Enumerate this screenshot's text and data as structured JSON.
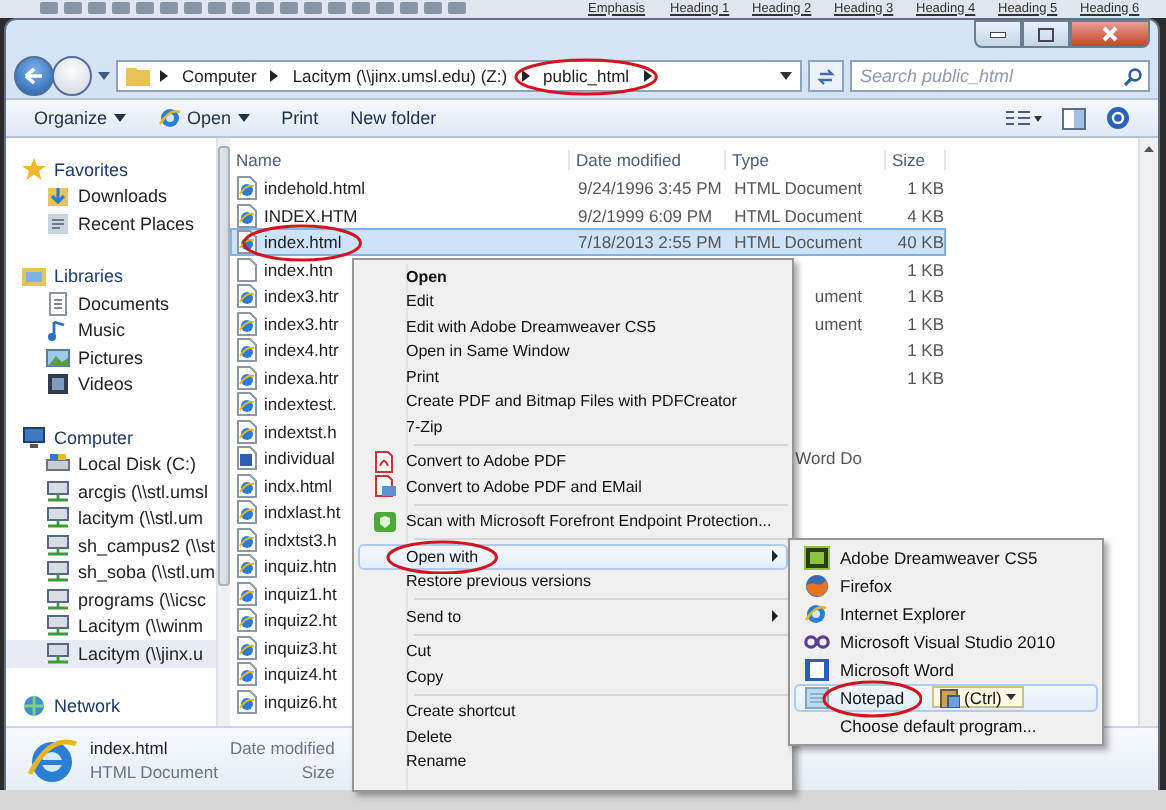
{
  "editor_ribbon": {
    "styles": [
      "Emphasis",
      "Heading 1",
      "Heading 2",
      "Heading 3",
      "Heading 4",
      "Heading 5",
      "Heading 6"
    ]
  },
  "address_bar": {
    "crumbs": [
      "Computer",
      "Lacitym (\\\\jinx.umsl.edu) (Z:)",
      "public_html"
    ]
  },
  "search": {
    "placeholder": "Search public_html"
  },
  "toolbar": {
    "buttons": [
      {
        "label": "Organize",
        "dropdown": true,
        "kind": "text"
      },
      {
        "label": "Open",
        "dropdown": true,
        "kind": "browser"
      },
      {
        "label": "Print",
        "dropdown": false,
        "kind": "text"
      },
      {
        "label": "New folder",
        "dropdown": false,
        "kind": "text"
      }
    ]
  },
  "navigation": {
    "groups": [
      {
        "label": "Favorites",
        "kind": "favorites",
        "children": [
          {
            "label": "Downloads",
            "kind": "downloads",
            "selected": false
          },
          {
            "label": "Recent Places",
            "kind": "recent",
            "selected": false
          }
        ]
      },
      {
        "label": "Libraries",
        "kind": "libraries",
        "children": [
          {
            "label": "Documents",
            "kind": "documents",
            "selected": false
          },
          {
            "label": "Music",
            "kind": "music",
            "selected": false
          },
          {
            "label": "Pictures",
            "kind": "pictures",
            "selected": false
          },
          {
            "label": "Videos",
            "kind": "videos",
            "selected": false
          }
        ]
      },
      {
        "label": "Computer",
        "kind": "computer",
        "children": [
          {
            "label": "Local Disk (C:)",
            "kind": "disk",
            "selected": false
          },
          {
            "label": "arcgis (\\\\stl.umsl",
            "kind": "share",
            "selected": false
          },
          {
            "label": "lacitym (\\\\stl.um",
            "kind": "share",
            "selected": false
          },
          {
            "label": "sh_campus2 (\\\\st",
            "kind": "share",
            "selected": false
          },
          {
            "label": "sh_soba (\\\\stl.um",
            "kind": "share",
            "selected": false
          },
          {
            "label": "programs (\\\\icsc",
            "kind": "share",
            "selected": false
          },
          {
            "label": "Lacitym (\\\\winm",
            "kind": "share",
            "selected": false
          },
          {
            "label": "Lacitym (\\\\jinx.u",
            "kind": "share",
            "selected": true
          }
        ]
      },
      {
        "label": "Network",
        "kind": "network"
      }
    ]
  },
  "file_list": {
    "columns": [
      "Name",
      "Date modified",
      "Type",
      "Size"
    ],
    "rows": [
      {
        "name": "indehold.html",
        "date": "9/24/1996 3:45 PM",
        "type": "HTML Document",
        "size": "1 KB",
        "kind": "html",
        "selected": false
      },
      {
        "name": "INDEX.HTM",
        "date": "9/2/1999 6:09 PM",
        "type": "HTML Document",
        "size": "4 KB",
        "kind": "html",
        "selected": false
      },
      {
        "name": "index.html",
        "date": "7/18/2013 2:55 PM",
        "type": "HTML Document",
        "size": "40 KB",
        "kind": "html",
        "selected": true
      },
      {
        "name": "index.htn",
        "size": "1 KB",
        "kind": "plain",
        "selected": false
      },
      {
        "name": "index3.htr",
        "type": "ument",
        "size": "1 KB",
        "kind": "html",
        "selected": false
      },
      {
        "name": "index3.htr",
        "type": "ument",
        "size": "1 KB",
        "kind": "html",
        "selected": false
      },
      {
        "name": "index4.htr",
        "size": "1 KB",
        "kind": "html",
        "selected": false
      },
      {
        "name": "indexa.htr",
        "size": "1 KB",
        "kind": "html",
        "selected": false
      },
      {
        "name": "indextest.",
        "kind": "html",
        "selected": false
      },
      {
        "name": "indextst.h",
        "kind": "html",
        "selected": false
      },
      {
        "name": "individual",
        "type": "Word Do",
        "kind": "word",
        "selected": false
      },
      {
        "name": "indx.html",
        "kind": "html",
        "selected": false
      },
      {
        "name": "indxlast.ht",
        "kind": "html",
        "selected": false
      },
      {
        "name": "indxtst3.h",
        "kind": "html",
        "selected": false
      },
      {
        "name": "inquiz.htn",
        "kind": "html",
        "selected": false
      },
      {
        "name": "inquiz1.ht",
        "kind": "html",
        "selected": false
      },
      {
        "name": "inquiz2.ht",
        "kind": "html",
        "selected": false
      },
      {
        "name": "inquiz3.ht",
        "kind": "html",
        "selected": false
      },
      {
        "name": "inquiz4.ht",
        "kind": "html",
        "selected": false
      },
      {
        "name": "inquiz6.ht",
        "kind": "html",
        "selected": false
      }
    ]
  },
  "details_pane": {
    "name": "index.html",
    "type": "HTML Document",
    "fields": [
      "Date modified",
      "Size"
    ]
  },
  "context_menu": {
    "groups": [
      [
        {
          "label": "Open",
          "kind": "default",
          "selected": false
        },
        {
          "label": "Edit",
          "kind": "plain",
          "selected": false
        },
        {
          "label": "Edit with Adobe Dreamweaver CS5",
          "kind": "plain",
          "selected": false
        },
        {
          "label": "Open in Same Window",
          "kind": "plain",
          "selected": false
        },
        {
          "label": "Print",
          "kind": "plain",
          "selected": false
        },
        {
          "label": "Create PDF and Bitmap Files with PDFCreator",
          "kind": "plain",
          "selected": false
        },
        {
          "label": "7-Zip",
          "kind": "plain",
          "selected": false
        }
      ],
      [
        {
          "label": "Convert to Adobe PDF",
          "kind": "pdf",
          "selected": false
        },
        {
          "label": "Convert to Adobe PDF and EMail",
          "kind": "pdfmail",
          "selected": false
        }
      ],
      [
        {
          "label": "Scan with Microsoft Forefront Endpoint Protection...",
          "kind": "shield",
          "selected": false
        }
      ],
      [
        {
          "label": "Open with",
          "kind": "submenu",
          "selected": true
        },
        {
          "label": "Restore previous versions",
          "kind": "plain",
          "selected": false
        }
      ],
      [
        {
          "label": "Send to",
          "kind": "submenu",
          "selected": false
        }
      ],
      [
        {
          "label": "Cut",
          "kind": "plain",
          "selected": false
        },
        {
          "label": "Copy",
          "kind": "plain",
          "selected": false
        }
      ],
      [
        {
          "label": "Create shortcut",
          "kind": "plain",
          "selected": false
        },
        {
          "label": "Delete",
          "kind": "plain",
          "selected": false
        },
        {
          "label": "Rename",
          "kind": "plain",
          "selected": false
        }
      ]
    ]
  },
  "open_with_menu": {
    "items": [
      {
        "label": "Adobe Dreamweaver CS5",
        "kind": "dreamweaver",
        "selected": false
      },
      {
        "label": "Firefox",
        "kind": "firefox",
        "selected": false
      },
      {
        "label": "Internet Explorer",
        "kind": "ie",
        "selected": false
      },
      {
        "label": "Microsoft Visual Studio 2010",
        "kind": "studio",
        "selected": false
      },
      {
        "label": "Microsoft Word",
        "kind": "word",
        "selected": false
      },
      {
        "label": "Notepad",
        "kind": "notepad",
        "selected": true
      },
      {
        "label": "Choose default program...",
        "kind": "command",
        "selected": false
      }
    ]
  },
  "paste_options": {
    "label": "(Ctrl)"
  }
}
